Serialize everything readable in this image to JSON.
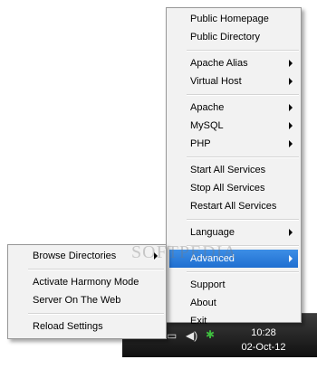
{
  "main_menu": {
    "items": [
      {
        "label": "Public Homepage",
        "submenu": false
      },
      {
        "label": "Public Directory",
        "submenu": false
      },
      {
        "label": "Apache Alias",
        "submenu": true
      },
      {
        "label": "Virtual Host",
        "submenu": true
      },
      {
        "label": "Apache",
        "submenu": true
      },
      {
        "label": "MySQL",
        "submenu": true
      },
      {
        "label": "PHP",
        "submenu": true
      },
      {
        "label": "Start All Services",
        "submenu": false
      },
      {
        "label": "Stop All Services",
        "submenu": false
      },
      {
        "label": "Restart All Services",
        "submenu": false
      },
      {
        "label": "Language",
        "submenu": true
      },
      {
        "label": "Advanced",
        "submenu": true,
        "highlighted": true
      },
      {
        "label": "Support",
        "submenu": false
      },
      {
        "label": "About",
        "submenu": false
      },
      {
        "label": "Exit",
        "submenu": false
      }
    ]
  },
  "sub_menu": {
    "items": [
      {
        "label": "Browse Directories",
        "submenu": true
      },
      {
        "label": "Activate Harmony Mode",
        "submenu": false
      },
      {
        "label": "Server On The Web",
        "submenu": false
      },
      {
        "label": "Reload Settings",
        "submenu": false
      }
    ]
  },
  "taskbar": {
    "time": "10:28",
    "date": "02-Oct-12"
  },
  "watermark": "SOFTPEDIA",
  "colors": {
    "highlight": "#2a7ad8",
    "menu_bg": "#f2f2f2",
    "taskbar": "#1a1a1a"
  }
}
